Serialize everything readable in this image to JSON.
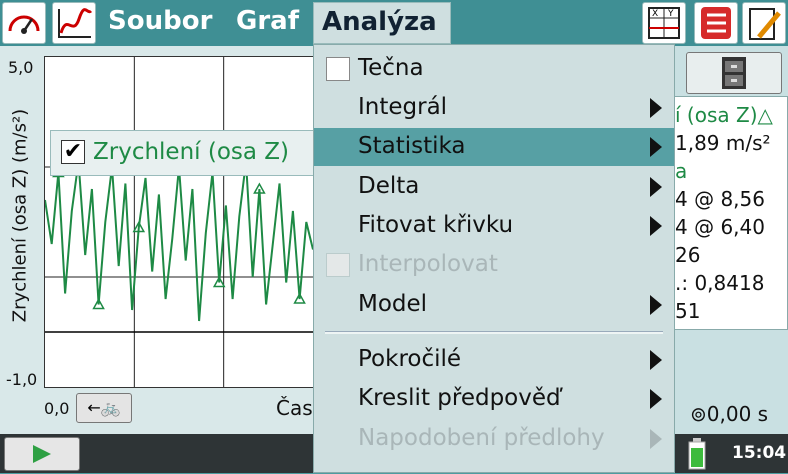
{
  "menubar": {
    "file": "Soubor",
    "graph": "Graf",
    "analysis": "Analýza"
  },
  "graph": {
    "y_max": "5,0",
    "y_min": "-1,0",
    "y_label": "Zrychlení (osa Z) (m/s²)",
    "x_start": "0,0",
    "x_label": "Čas",
    "x_button": "←🚲",
    "legend_label": "Zrychlení (osa Z)",
    "legend_check": "✔",
    "series_color": "#1e8a45"
  },
  "stats": {
    "lines": [
      "í (osa Z)△",
      "1,89 m/s²",
      "a",
      "4 @ 8,56",
      "4 @ 6,40",
      "26",
      ".: 0,8418",
      "51"
    ]
  },
  "time_display": "⊚0,00 s",
  "status": {
    "clock": "15:04"
  },
  "menu": {
    "items": [
      {
        "label": "Tečna"
      },
      {
        "label": "Integrál"
      },
      {
        "label": "Statistika"
      },
      {
        "label": "Delta"
      },
      {
        "label": "Fitovat křivku"
      },
      {
        "label": "Interpolovat"
      },
      {
        "label": "Model"
      },
      {
        "label": "Pokročilé"
      },
      {
        "label": "Kreslit předpověď"
      },
      {
        "label": "Napodobení předlohy"
      }
    ]
  },
  "chart_data": {
    "type": "line",
    "x": [
      0,
      1,
      2,
      3,
      4,
      5,
      6,
      7,
      8,
      9,
      10,
      11,
      12,
      13,
      14,
      15,
      16,
      17,
      18,
      19,
      20,
      21,
      22,
      23,
      24,
      25,
      26,
      27,
      28,
      29,
      30,
      31,
      32,
      33,
      34,
      35,
      36,
      37,
      38,
      39,
      40
    ],
    "series": [
      {
        "values": [
          2.4,
          1.6,
          2.9,
          0.7,
          2.2,
          3.1,
          1.4,
          2.6,
          0.5,
          2.0,
          3.0,
          1.2,
          2.7,
          0.4,
          1.9,
          2.8,
          1.1,
          2.5,
          0.6,
          1.7,
          3.0,
          1.3,
          2.6,
          0.2,
          1.8,
          2.9,
          0.9,
          2.3,
          0.6,
          2.1,
          3.1,
          1.0,
          2.6,
          0.5,
          1.6,
          2.7,
          0.9,
          2.2,
          0.6,
          2.0,
          1.5
        ]
      }
    ],
    "ylim": [
      -1.0,
      5.0
    ]
  }
}
